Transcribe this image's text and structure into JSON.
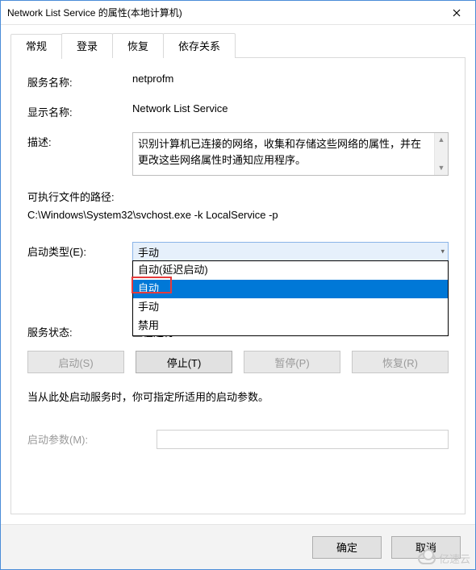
{
  "window_title": "Network List Service 的属性(本地计算机)",
  "tabs": [
    "常规",
    "登录",
    "恢复",
    "依存关系"
  ],
  "labels": {
    "service_name": "服务名称:",
    "display_name": "显示名称:",
    "description": "描述:",
    "exec_path": "可执行文件的路径:",
    "startup_type": "启动类型(E):",
    "service_status": "服务状态:",
    "param_hint": "当从此处启动服务时，你可指定所适用的启动参数。",
    "start_params": "启动参数(M):"
  },
  "values": {
    "service_name": "netprofm",
    "display_name": "Network List Service",
    "description": "识别计算机已连接的网络，收集和存储这些网络的属性，并在更改这些网络属性时通知应用程序。",
    "exec_path": "C:\\Windows\\System32\\svchost.exe -k LocalService -p",
    "startup_type_selected": "手动",
    "service_status_value": "正在运行"
  },
  "startup_options": [
    "自动(延迟启动)",
    "自动",
    "手动",
    "禁用"
  ],
  "highlighted_option_index": 1,
  "action_buttons": {
    "start": "启动(S)",
    "stop": "停止(T)",
    "pause": "暂停(P)",
    "resume": "恢复(R)"
  },
  "footer_buttons": {
    "ok": "确定",
    "cancel": "取消"
  },
  "watermark": "亿速云"
}
